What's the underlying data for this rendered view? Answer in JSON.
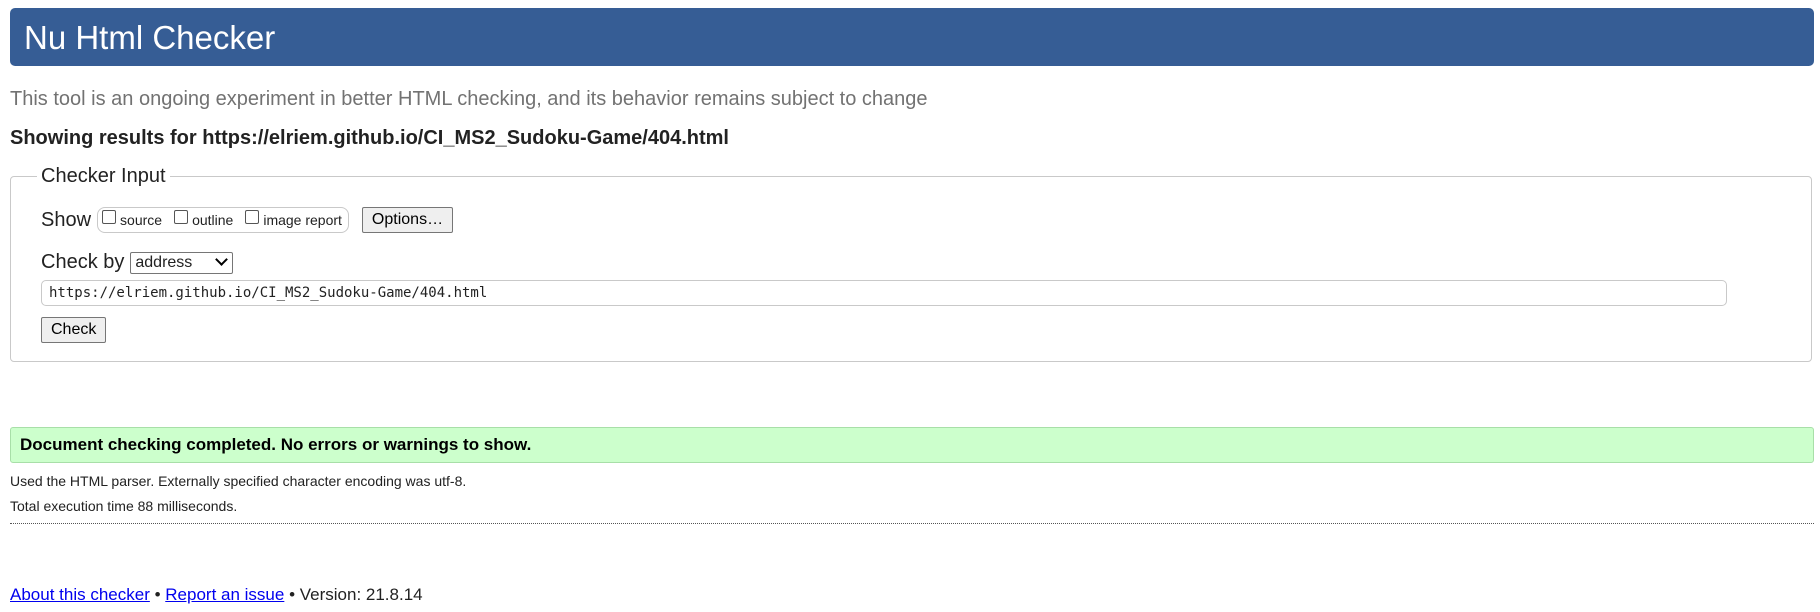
{
  "header": {
    "title": "Nu Html Checker"
  },
  "intro_text": "This tool is an ongoing experiment in better HTML checking, and its behavior remains subject to change",
  "results_heading": "Showing results for https://elriem.github.io/CI_MS2_Sudoku-Game/404.html",
  "checker_input": {
    "legend": "Checker Input",
    "show_label": "Show",
    "show_options": [
      {
        "label": "source",
        "checked": false
      },
      {
        "label": "outline",
        "checked": false
      },
      {
        "label": "image report",
        "checked": false
      }
    ],
    "options_button": "Options…",
    "check_by_label": "Check by",
    "check_by_value": "address",
    "url_value": "https://elriem.github.io/CI_MS2_Sudoku-Game/404.html",
    "check_button": "Check"
  },
  "result": {
    "message": "Document checking completed. No errors or warnings to show.",
    "status_color": "#ccffcc",
    "parser_info": "Used the HTML parser. Externally specified character encoding was utf-8.",
    "execution_time": "Total execution time 88 milliseconds."
  },
  "footer": {
    "about_link": "About this checker",
    "separator": " • ",
    "report_link": "Report an issue",
    "version_text": " • Version: 21.8.14"
  },
  "colors": {
    "header_bg": "#365d95",
    "link": "#0000ee"
  }
}
